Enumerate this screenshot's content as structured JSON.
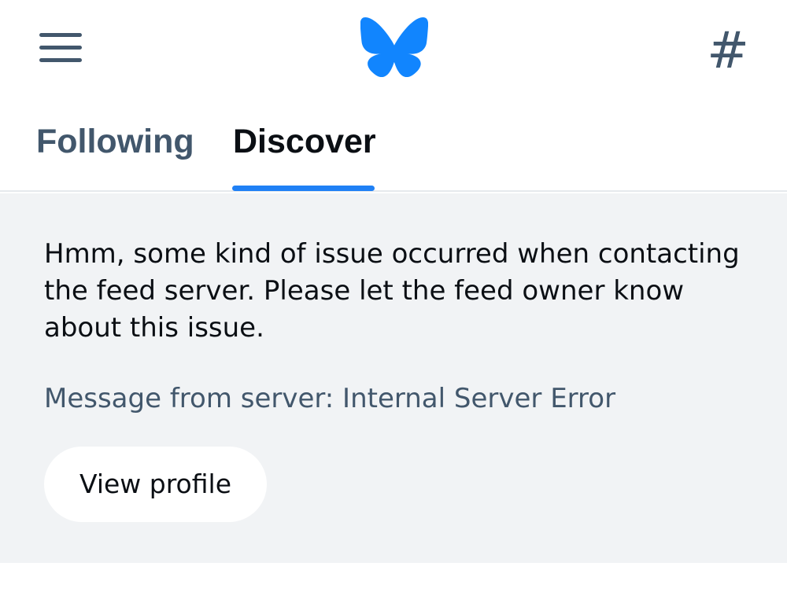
{
  "header": {
    "menu_icon": "menu-icon",
    "logo_icon": "butterfly-logo-icon",
    "hashtag_icon": "hashtag-icon",
    "hashtag_glyph": "#",
    "brand_color": "#1185fe"
  },
  "tabs": [
    {
      "label": "Following",
      "selected": false
    },
    {
      "label": "Discover",
      "selected": true
    }
  ],
  "error": {
    "message": "Hmm, some kind of issue occurred when contacting the feed server. Please let the feed owner know about this issue.",
    "server_message": "Message from server: Internal Server Error",
    "button_label": "View profile"
  }
}
